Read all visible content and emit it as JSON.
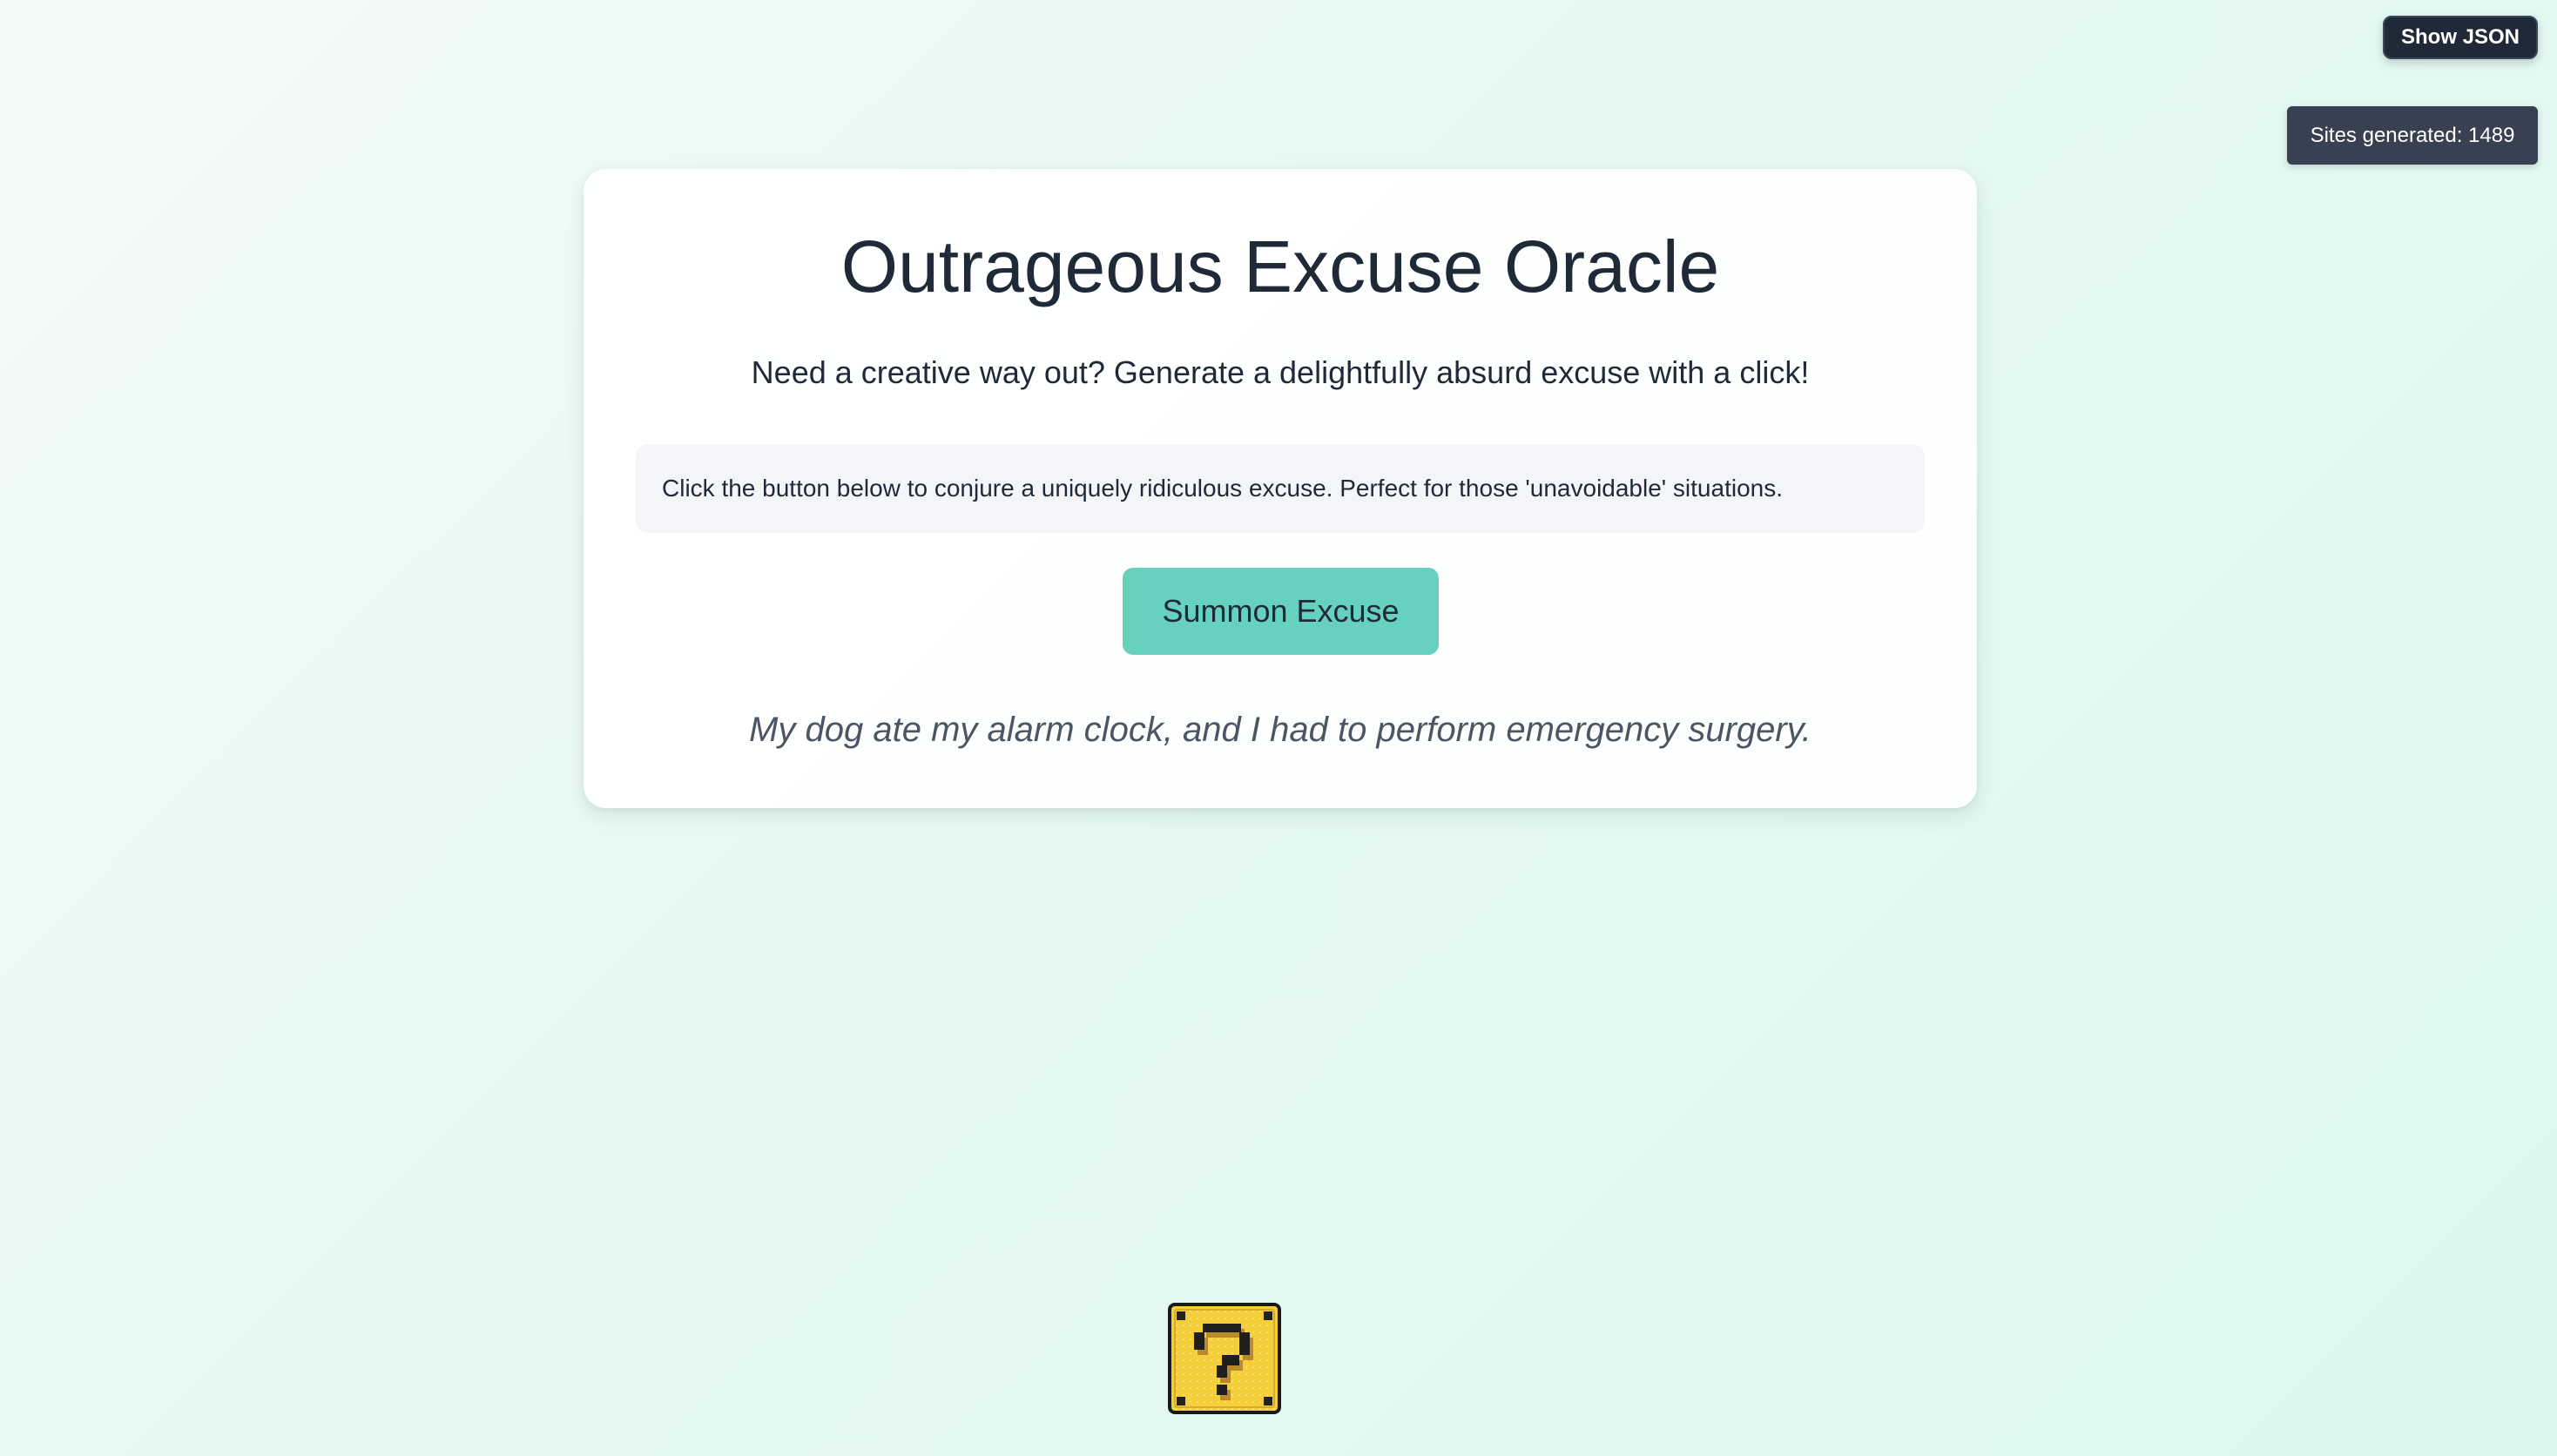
{
  "toolbar": {
    "show_json_label": "Show JSON",
    "sites_generated": "Sites generated: 1489"
  },
  "card": {
    "title": "Outrageous Excuse Oracle",
    "subtitle": "Need a creative way out? Generate a delightfully absurd excuse with a click!",
    "info": "Click the button below to conjure a uniquely ridiculous excuse. Perfect for those 'unavoidable' situations.",
    "button_label": "Summon Excuse",
    "excuse": "My dog ate my alarm clock, and I had to perform emergency surgery."
  },
  "icons": {
    "mystery_block": "question-block-icon"
  },
  "colors": {
    "accent": "#66d1bc",
    "dark": "#1f2937",
    "badge": "#374151",
    "block_yellow": "#f5cf3a"
  }
}
